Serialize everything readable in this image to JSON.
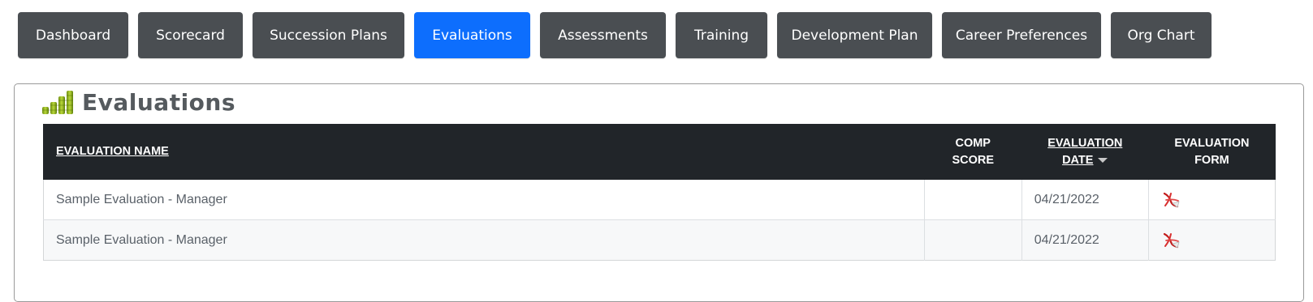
{
  "tabs": [
    {
      "label": "Dashboard",
      "active": false
    },
    {
      "label": "Scorecard",
      "active": false
    },
    {
      "label": "Succession Plans",
      "active": false
    },
    {
      "label": "Evaluations",
      "active": true
    },
    {
      "label": "Assessments",
      "active": false
    },
    {
      "label": "Training",
      "active": false
    },
    {
      "label": "Development Plan",
      "active": false
    },
    {
      "label": "Career Preferences",
      "active": false
    },
    {
      "label": "Org Chart",
      "active": false
    }
  ],
  "panel": {
    "title": "Evaluations",
    "icon": "bar-chart-icon"
  },
  "table": {
    "headers": {
      "name": "EVALUATION NAME",
      "comp_score_line1": "COMP",
      "comp_score_line2": "SCORE",
      "date_line1": "EVALUATION",
      "date_line2": "DATE",
      "form_line1": "EVALUATION",
      "form_line2": "FORM"
    },
    "sort": {
      "column": "EVALUATION DATE",
      "direction": "descending"
    },
    "rows": [
      {
        "name": "Sample Evaluation - Manager",
        "comp_score": "",
        "date": "04/21/2022",
        "form_icon": "pdf-icon"
      },
      {
        "name": "Sample Evaluation - Manager",
        "comp_score": "",
        "date": "04/21/2022",
        "form_icon": "pdf-icon"
      }
    ]
  },
  "colors": {
    "tab_bg": "#4a4e52",
    "tab_active_bg": "#0d6efd",
    "table_header_bg": "#212529",
    "title_text": "#555a5e",
    "cell_text": "#5a6169"
  }
}
